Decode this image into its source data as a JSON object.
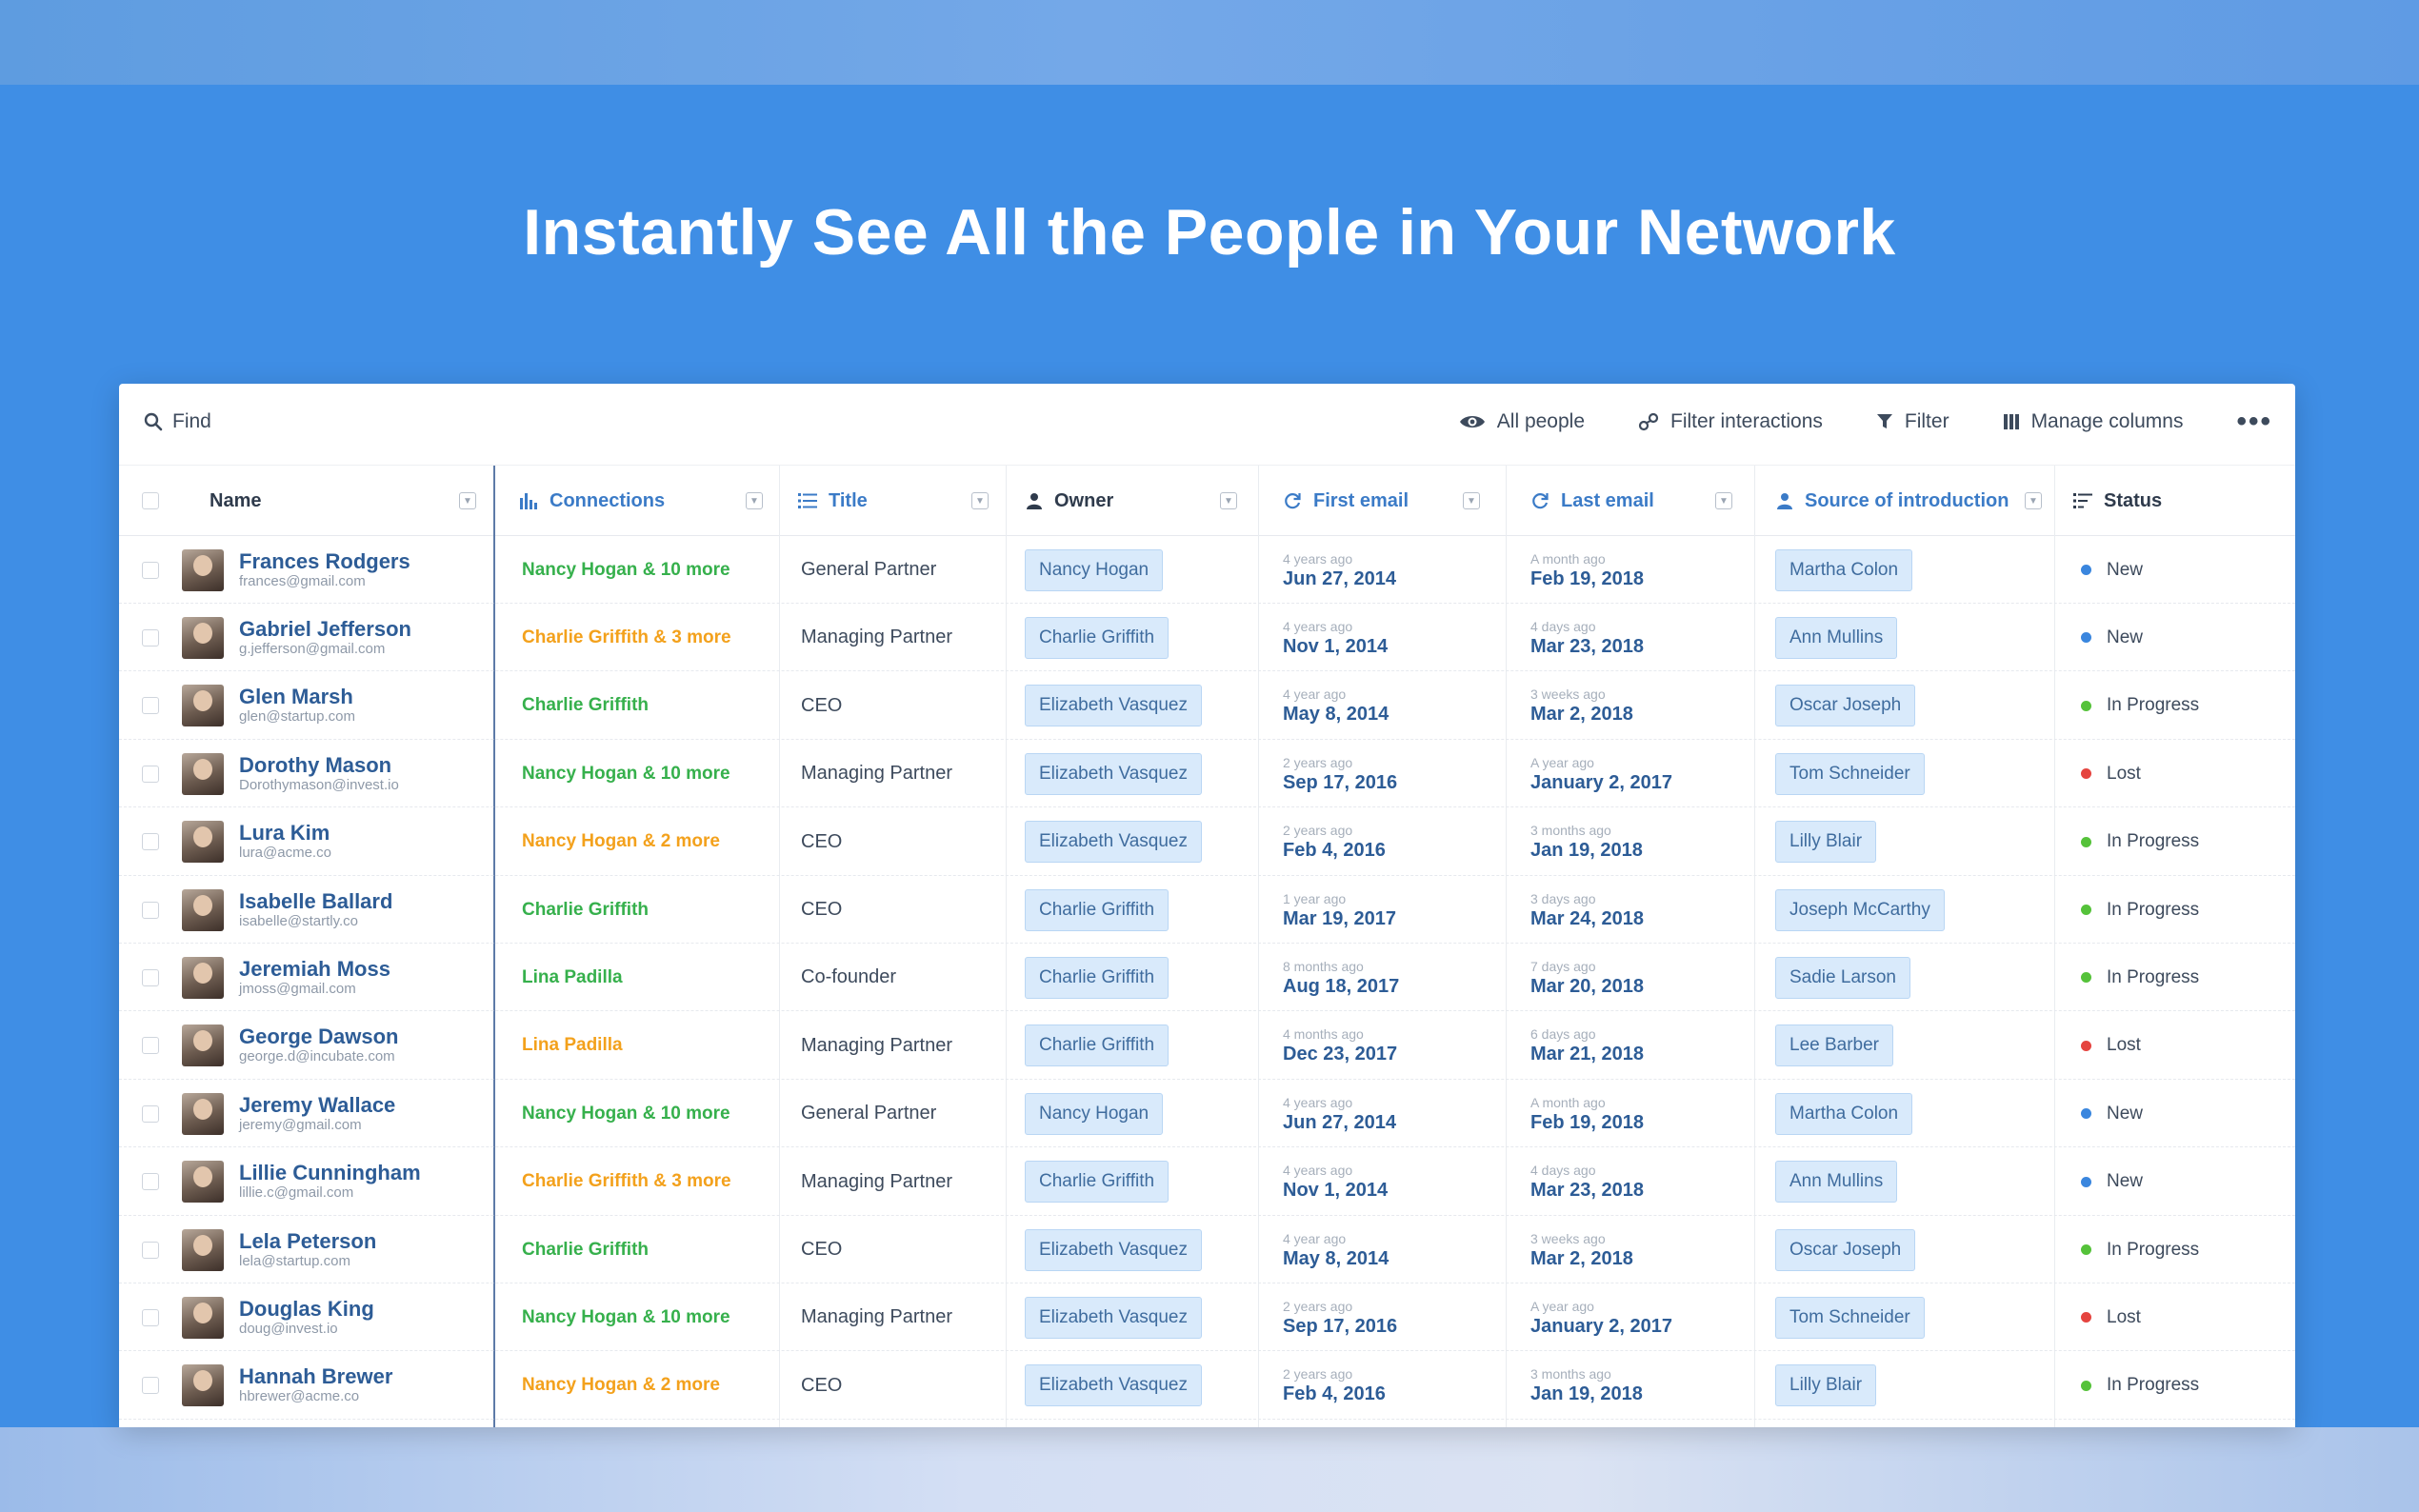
{
  "headline": "Instantly See All the People in Your Network",
  "toolbar": {
    "find_label": "Find",
    "all_people_label": "All people",
    "filter_interactions_label": "Filter interactions",
    "filter_label": "Filter",
    "manage_columns_label": "Manage columns",
    "more_label": "•••"
  },
  "columns": {
    "name": "Name",
    "connections": "Connections",
    "title": "Title",
    "owner": "Owner",
    "first_email": "First email",
    "last_email": "Last email",
    "source": "Source of introduction",
    "status": "Status"
  },
  "colors": {
    "new": "#3a86de",
    "in_progress": "#55c23a",
    "lost": "#e5443f",
    "conn_green": "#36b04c",
    "conn_orange": "#f3a11c"
  },
  "rows": [
    {
      "name": "Frances Rodgers",
      "email": "frances@gmail.com",
      "connections": "Nancy Hogan & 10 more",
      "conn_color": "green",
      "title": "General Partner",
      "owner": "Nancy Hogan",
      "first_ago": "4 years ago",
      "first_date": "Jun 27, 2014",
      "last_ago": "A month ago",
      "last_date": "Feb 19, 2018",
      "source": "Martha Colon",
      "status": "New",
      "status_key": "new"
    },
    {
      "name": "Gabriel Jefferson",
      "email": "g.jefferson@gmail.com",
      "connections": "Charlie Griffith & 3 more",
      "conn_color": "orange",
      "title": "Managing Partner",
      "owner": "Charlie Griffith",
      "first_ago": "4 years ago",
      "first_date": "Nov 1, 2014",
      "last_ago": "4 days ago",
      "last_date": "Mar 23, 2018",
      "source": "Ann Mullins",
      "status": "New",
      "status_key": "new"
    },
    {
      "name": "Glen Marsh",
      "email": "glen@startup.com",
      "connections": "Charlie Griffith",
      "conn_color": "green",
      "title": "CEO",
      "owner": "Elizabeth Vasquez",
      "first_ago": "4 year ago",
      "first_date": "May 8, 2014",
      "last_ago": "3 weeks ago",
      "last_date": "Mar 2, 2018",
      "source": "Oscar Joseph",
      "status": "In Progress",
      "status_key": "in_progress"
    },
    {
      "name": "Dorothy Mason",
      "email": "Dorothymason@invest.io",
      "connections": "Nancy Hogan & 10 more",
      "conn_color": "green",
      "title": "Managing Partner",
      "owner": "Elizabeth Vasquez",
      "first_ago": "2 years ago",
      "first_date": "Sep 17, 2016",
      "last_ago": "A year ago",
      "last_date": "January 2, 2017",
      "source": "Tom Schneider",
      "status": "Lost",
      "status_key": "lost"
    },
    {
      "name": "Lura Kim",
      "email": "lura@acme.co",
      "connections": "Nancy Hogan & 2 more",
      "conn_color": "orange",
      "title": "CEO",
      "owner": "Elizabeth Vasquez",
      "first_ago": "2 years ago",
      "first_date": "Feb 4, 2016",
      "last_ago": "3 months ago",
      "last_date": "Jan 19, 2018",
      "source": "Lilly Blair",
      "status": "In Progress",
      "status_key": "in_progress"
    },
    {
      "name": "Isabelle Ballard",
      "email": "isabelle@startly.co",
      "connections": "Charlie Griffith",
      "conn_color": "green",
      "title": "CEO",
      "owner": "Charlie Griffith",
      "first_ago": "1 year ago",
      "first_date": "Mar 19, 2017",
      "last_ago": "3 days ago",
      "last_date": "Mar 24, 2018",
      "source": "Joseph McCarthy",
      "status": "In Progress",
      "status_key": "in_progress"
    },
    {
      "name": "Jeremiah Moss",
      "email": "jmoss@gmail.com",
      "connections": "Lina Padilla",
      "conn_color": "green",
      "title": "Co-founder",
      "owner": "Charlie Griffith",
      "first_ago": "8 months ago",
      "first_date": "Aug 18, 2017",
      "last_ago": "7 days ago",
      "last_date": "Mar 20, 2018",
      "source": "Sadie Larson",
      "status": "In Progress",
      "status_key": "in_progress"
    },
    {
      "name": "George Dawson",
      "email": "george.d@incubate.com",
      "connections": "Lina Padilla",
      "conn_color": "orange",
      "title": "Managing Partner",
      "owner": "Charlie Griffith",
      "first_ago": "4 months ago",
      "first_date": "Dec 23, 2017",
      "last_ago": "6 days ago",
      "last_date": "Mar 21, 2018",
      "source": "Lee Barber",
      "status": "Lost",
      "status_key": "lost"
    },
    {
      "name": "Jeremy Wallace",
      "email": "jeremy@gmail.com",
      "connections": "Nancy Hogan & 10 more",
      "conn_color": "green",
      "title": "General Partner",
      "owner": "Nancy Hogan",
      "first_ago": "4 years ago",
      "first_date": "Jun 27, 2014",
      "last_ago": "A month ago",
      "last_date": "Feb 19, 2018",
      "source": "Martha Colon",
      "status": "New",
      "status_key": "new"
    },
    {
      "name": "Lillie Cunningham",
      "email": "lillie.c@gmail.com",
      "connections": "Charlie Griffith & 3 more",
      "conn_color": "orange",
      "title": "Managing Partner",
      "owner": "Charlie Griffith",
      "first_ago": "4 years ago",
      "first_date": "Nov 1, 2014",
      "last_ago": "4 days ago",
      "last_date": "Mar 23, 2018",
      "source": "Ann Mullins",
      "status": "New",
      "status_key": "new"
    },
    {
      "name": "Lela Peterson",
      "email": "lela@startup.com",
      "connections": "Charlie Griffith",
      "conn_color": "green",
      "title": "CEO",
      "owner": "Elizabeth Vasquez",
      "first_ago": "4 year ago",
      "first_date": "May 8, 2014",
      "last_ago": "3 weeks ago",
      "last_date": "Mar 2, 2018",
      "source": "Oscar Joseph",
      "status": "In Progress",
      "status_key": "in_progress"
    },
    {
      "name": "Douglas King",
      "email": "doug@invest.io",
      "connections": "Nancy Hogan & 10 more",
      "conn_color": "green",
      "title": "Managing Partner",
      "owner": "Elizabeth Vasquez",
      "first_ago": "2 years ago",
      "first_date": "Sep 17, 2016",
      "last_ago": "A year ago",
      "last_date": "January 2, 2017",
      "source": "Tom Schneider",
      "status": "Lost",
      "status_key": "lost"
    },
    {
      "name": "Hannah Brewer",
      "email": "hbrewer@acme.co",
      "connections": "Nancy Hogan & 2 more",
      "conn_color": "orange",
      "title": "CEO",
      "owner": "Elizabeth Vasquez",
      "first_ago": "2 years ago",
      "first_date": "Feb 4, 2016",
      "last_ago": "3 months ago",
      "last_date": "Jan 19, 2018",
      "source": "Lilly Blair",
      "status": "In Progress",
      "status_key": "in_progress"
    }
  ]
}
